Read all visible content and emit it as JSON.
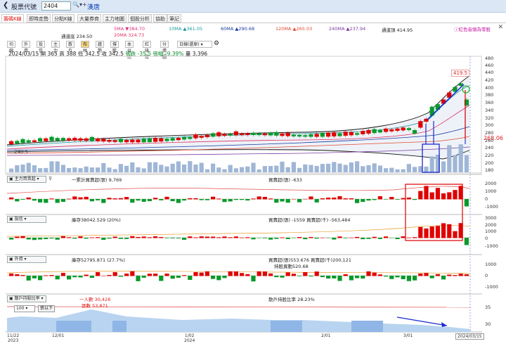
{
  "topbar": {
    "back_icon": "chevron-left-icon",
    "label": "股票代號",
    "code": "2404",
    "search_icon": "search-icon",
    "stock_name": "漢唐"
  },
  "tabs": [
    "籌碼K線",
    "即時走勢",
    "分點K線",
    "大量券商",
    "主力地圖",
    "個股分析",
    "協助",
    "筆記"
  ],
  "legend": {
    "ma5": "5MA ▼384.70",
    "ma10": "10MA ▲361.05",
    "ma60": "60MA ▲290.68",
    "ma120": "120MA ▲265.03",
    "ma240": "240MA ▲237.94",
    "upper": "通道頂 414.95",
    "lower": "通道底 234.50",
    "ma20": "20MA 324.73",
    "warning": "ⓘ紅色音頭為零股",
    "colors": {
      "ma5": "#e0307a",
      "ma10": "#1a9a9a",
      "ma60": "#1a3aa0",
      "ma120": "#e04a30",
      "ma240": "#7a3aa0",
      "ma20": "#e03060"
    }
  },
  "toolbar": {
    "buttons": [
      "均線",
      "外資",
      "投信",
      "主力",
      "散戶",
      "布林",
      "趨勢",
      "撐壓",
      "本益比",
      "紅綠燈",
      "分價圖"
    ],
    "active": "布林",
    "period": "日線(還原)",
    "settings_icon": "gear-icon"
  },
  "ohlc": {
    "date": "2024/03/15",
    "open": "開 365",
    "high": "高 388",
    "low": "低 342.5",
    "close": "收 342.5",
    "change": "張跌 -35.5",
    "pct": "張幅 -9.39%",
    "volume": "量 3,396"
  },
  "price_axis": [
    "480",
    "460",
    "440",
    "420",
    "400",
    "380",
    "360",
    "340",
    "320",
    "300",
    "280",
    "260",
    "240",
    "220",
    "200",
    "180"
  ],
  "price_marks": {
    "high": "419.5",
    "last": "268.06",
    "low": "240.5"
  },
  "panels": [
    {
      "select": "主力買賣超",
      "left": "一累計買賣超(張) 9,769",
      "right": "買賣超(張) -633",
      "axis": [
        "2000",
        "1000",
        "0",
        "-1000"
      ]
    },
    {
      "select": "投信",
      "left": "庫存38042.529 (20%)",
      "right": "買賣超(張) -1559 買賣超(千) -563,484",
      "axis": [
        "3000",
        "2000",
        "1000",
        "0",
        "-1000"
      ]
    },
    {
      "select": "外資",
      "left": "庫存52795.871 (27.7%)",
      "right": "買賣超(張)553.676 買賣超(千)200,121",
      "right2": "持股異動520.68",
      "axis": [
        "1000",
        "0",
        "-1000"
      ]
    },
    {
      "select": "散戶持股比率",
      "left": "一人數 30,428",
      "left2": "張數 53,871",
      "right": "散戶持股比率 28.23%",
      "axis": [
        "35",
        "30"
      ],
      "sub_select": "100",
      "sub_label": "張以下"
    }
  ],
  "dates": [
    "11/22\n2023",
    "12/01",
    "1/02\n2024",
    "2/01",
    "3/01",
    "2024/03/15"
  ],
  "close_icon": "close-icon"
}
